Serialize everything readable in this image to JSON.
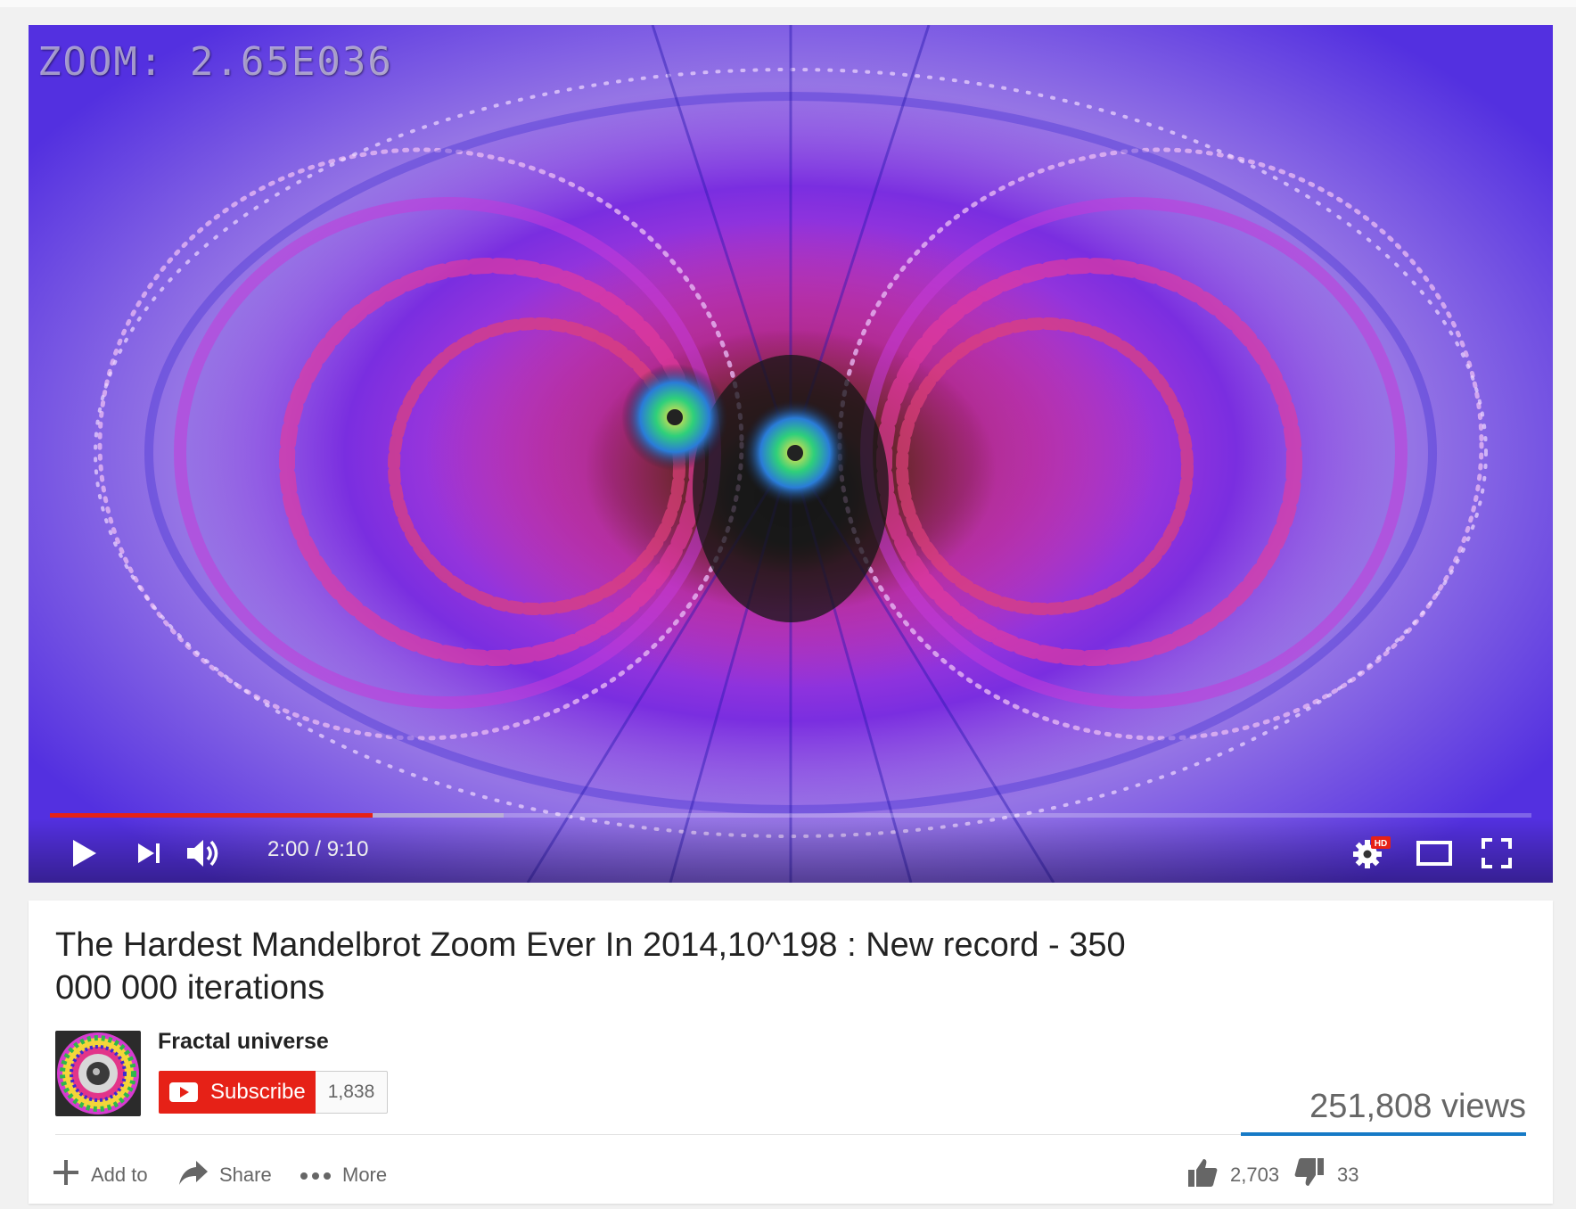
{
  "player": {
    "zoom_readout": "ZOOM: 2.65E036",
    "time_display": "2:00 / 9:10",
    "progress_played": 0.218,
    "progress_buffered": 0.306,
    "hd_badge": "HD",
    "controls": {
      "play_icon": "play-icon",
      "next_icon": "skip-next-icon",
      "volume_icon": "volume-icon",
      "settings_icon": "gear-icon",
      "theater_icon": "theater-mode-icon",
      "fullscreen_icon": "fullscreen-icon"
    }
  },
  "video": {
    "title": "The Hardest Mandelbrot Zoom Ever In 2014,10^198 : New record - 350 000 000 iterations",
    "views": "251,808 views"
  },
  "channel": {
    "name": "Fractal universe",
    "subscribe_label": "Subscribe",
    "subscriber_count": "1,838"
  },
  "actions": {
    "add_to": "Add to",
    "share": "Share",
    "more": "More"
  },
  "ratings": {
    "likes": "2,703",
    "dislikes": "33"
  },
  "colors": {
    "accent_red": "#e62117",
    "like_bar_blue": "#167ac6"
  }
}
